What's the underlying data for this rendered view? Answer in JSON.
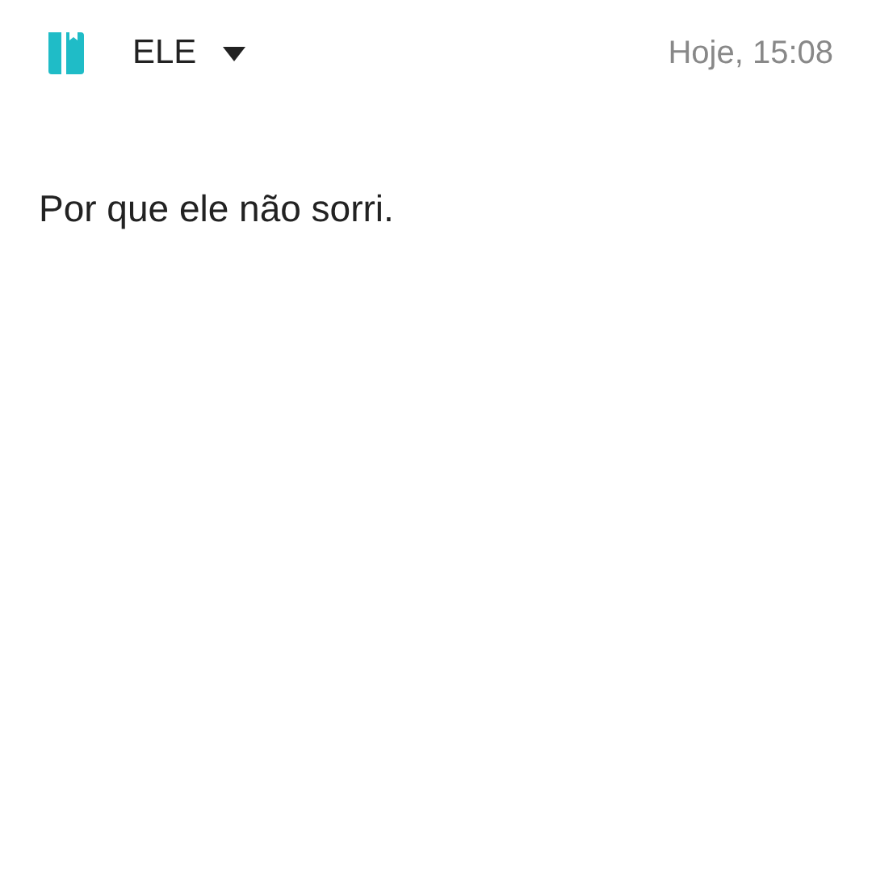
{
  "header": {
    "notebook": "ELE",
    "date": "Hoje, 15:08"
  },
  "note": {
    "text": "Por que ele não sorri."
  }
}
